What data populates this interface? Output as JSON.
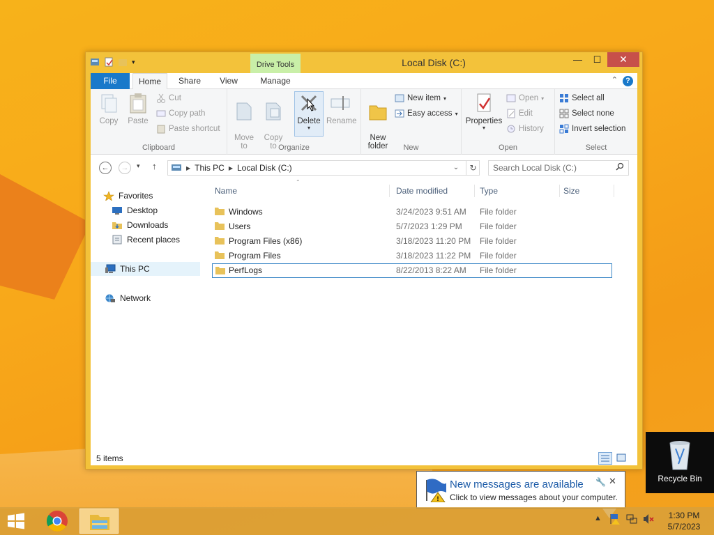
{
  "window": {
    "title": "Local Disk (C:)",
    "context_tab": "Drive Tools",
    "min": "—",
    "max": "☐",
    "close": "✕"
  },
  "ribbon": {
    "tabs": [
      "File",
      "Home",
      "Share",
      "View",
      "Manage"
    ],
    "help": "?",
    "groups": {
      "clipboard": {
        "label": "Clipboard",
        "copy": "Copy",
        "paste": "Paste",
        "cut": "Cut",
        "copy_path": "Copy path",
        "paste_shortcut": "Paste shortcut"
      },
      "organize": {
        "label": "Organize",
        "move_to": "Move\nto",
        "copy_to": "Copy\nto",
        "delete": "Delete",
        "rename": "Rename"
      },
      "new": {
        "label": "New",
        "new_folder": "New\nfolder",
        "new_item": "New item",
        "easy_access": "Easy access"
      },
      "open": {
        "label": "Open",
        "properties": "Properties",
        "open": "Open",
        "edit": "Edit",
        "history": "History"
      },
      "select": {
        "label": "Select",
        "select_all": "Select all",
        "select_none": "Select none",
        "invert_selection": "Invert selection"
      }
    }
  },
  "address": {
    "crumbs": [
      "This PC",
      "Local Disk (C:)"
    ],
    "search_placeholder": "Search Local Disk (C:)"
  },
  "nav_pane": {
    "favorites": "Favorites",
    "desktop": "Desktop",
    "downloads": "Downloads",
    "recent_places": "Recent places",
    "this_pc": "This PC",
    "network": "Network"
  },
  "columns": {
    "name": "Name",
    "date_modified": "Date modified",
    "type": "Type",
    "size": "Size"
  },
  "files": [
    {
      "name": "Windows",
      "date": "3/24/2023 9:51 AM",
      "type": "File folder"
    },
    {
      "name": "Users",
      "date": "5/7/2023 1:29 PM",
      "type": "File folder"
    },
    {
      "name": "Program Files (x86)",
      "date": "3/18/2023 11:20 PM",
      "type": "File folder"
    },
    {
      "name": "Program Files",
      "date": "3/18/2023 11:22 PM",
      "type": "File folder"
    },
    {
      "name": "PerfLogs",
      "date": "8/22/2013 8:22 AM",
      "type": "File folder"
    }
  ],
  "status": {
    "count": "5 items"
  },
  "desktop": {
    "recycle_bin": "Recycle Bin"
  },
  "balloon": {
    "title": "New messages are available",
    "text": "Click to view messages about your computer."
  },
  "clock": {
    "time": "1:30 PM",
    "date": "5/7/2023"
  },
  "colors": {
    "accent": "#1979ca",
    "window_frame": "#f3c23a",
    "close": "#c7504a"
  }
}
